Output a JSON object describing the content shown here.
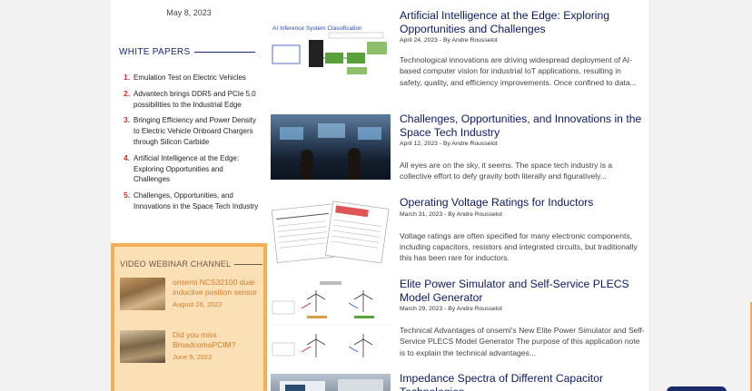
{
  "sidebar": {
    "top_date": "May 8, 2023",
    "white_papers": {
      "heading": "WHITE PAPERS",
      "items": [
        {
          "num": "1.",
          "title": "Emulation Test on Electric Vehicles"
        },
        {
          "num": "2.",
          "title": "Advantech brings DDR5 and PCIe 5.0 possibilities to the Industrial Edge"
        },
        {
          "num": "3.",
          "title": "Bringing Efficiency and Power Density to Electric Vehicle Onboard Chargers through Silicon Carbide"
        },
        {
          "num": "4.",
          "title": "Artificial Intelligence at the Edge: Exploring Opportunities and Challenges"
        },
        {
          "num": "5.",
          "title": "Challenges, Opportunities, and Innovations in the Space Tech Industry"
        }
      ]
    },
    "video": {
      "heading": "VIDEO WEBINAR CHANNEL",
      "items": [
        {
          "title": "onsemi NCS32100 dual-inductive position sensor",
          "date": "August 26, 2022"
        },
        {
          "title": "Did you miss BroadcomaPCIM?",
          "date": "June 9, 2022"
        }
      ]
    }
  },
  "articles": [
    {
      "thumb_caption": "AI Inference System Classification",
      "title": "Artificial Intelligence at the Edge: Exploring Opportunities and Challenges",
      "meta": "April 24, 2023 - By Andre Rousselot",
      "excerpt": "Technological innovations are driving widespread deployment of AI-based computer vision for industrial IoT applications, resulting in safety, quality, and efficiency improvements. Once confined to data..."
    },
    {
      "title": "Challenges, Opportunities, and Innovations in the Space Tech Industry",
      "meta": "April 12, 2023 - By Andre Rousselot",
      "excerpt": "All eyes are on the sky, it seems. The space tech industry is a collective effort to defy gravity both literally and figuratively..."
    },
    {
      "title": "Operating Voltage Ratings for Inductors",
      "meta": "March 31, 2023 - By Andre Rousselot",
      "excerpt": "Voltage ratings are often specified for many electronic components, including capacitors, resistors and integrated circuits, but traditionally this has been rare for inductors."
    },
    {
      "title": "Elite Power Simulator and Self-Service PLECS Model Generator",
      "meta": "March 29, 2023 - By Andre Rousselot",
      "excerpt": "Technical Advantages of onsemi's New Elite Power Simulator and Self-Service PLECS Model Generator The purpose of this application note is to explain the technical advantages..."
    },
    {
      "title": "Impedance Spectra of Different Capacitor Technologies"
    }
  ]
}
